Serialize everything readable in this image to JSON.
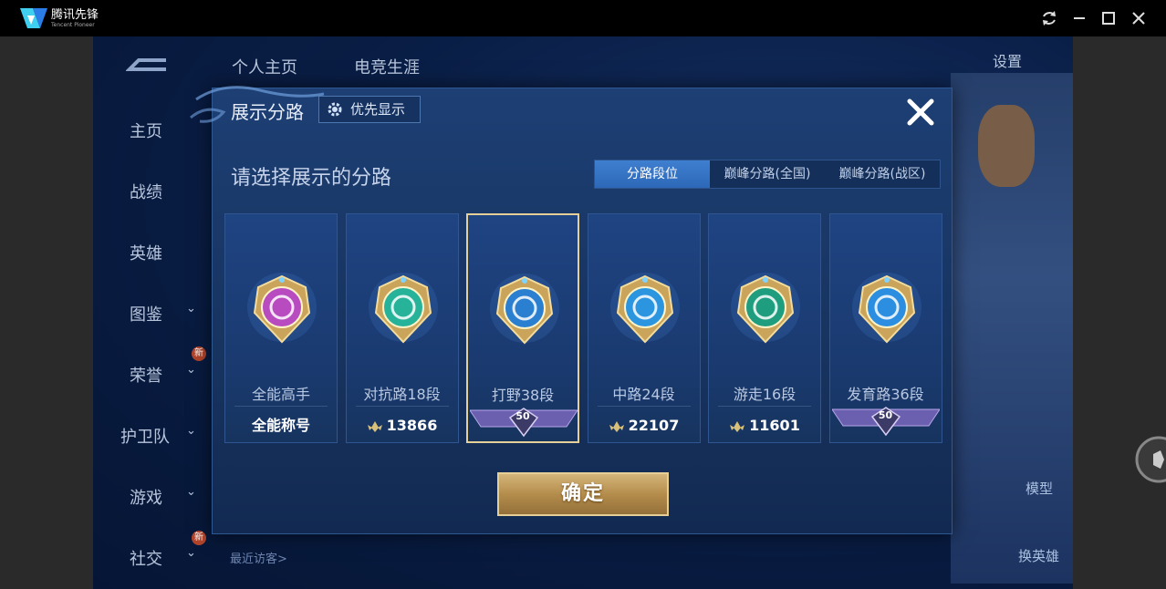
{
  "app": {
    "name": "腾讯先锋",
    "subtitle": "Tencent Pioneer"
  },
  "window_controls": [
    "refresh-icon",
    "minimize-icon",
    "maximize-icon",
    "close-icon"
  ],
  "game": {
    "top_tabs": [
      "个人主页",
      "电竞生涯"
    ],
    "sidebar": [
      "主页",
      "战绩",
      "英雄",
      "图鉴",
      "荣誉",
      "护卫队",
      "游戏",
      "社交"
    ],
    "new_badge": "新",
    "settings": "设置",
    "recent_visitors": "最近访客>",
    "right_buttons": {
      "model": "模型",
      "swap_hero": "换英雄"
    }
  },
  "modal": {
    "title": "展示分路",
    "priority_button": "优先显示",
    "subtitle": "请选择展示的分路",
    "tabs": [
      {
        "label": "分路段位",
        "active": true
      },
      {
        "label": "巅峰分路(全国)",
        "active": false
      },
      {
        "label": "巅峰分路(战区)",
        "active": false
      }
    ],
    "cards": [
      {
        "name": "全能高手",
        "footer": "全能称号",
        "kind": "title",
        "color": "#b84bc0"
      },
      {
        "name": "对抗路18段",
        "footer": "13866",
        "kind": "points",
        "color": "#27b39a"
      },
      {
        "name": "打野38段",
        "footer": "50",
        "kind": "level",
        "color": "#2a7fd0",
        "selected": true
      },
      {
        "name": "中路24段",
        "footer": "22107",
        "kind": "points",
        "color": "#2b95e0"
      },
      {
        "name": "游走16段",
        "footer": "11601",
        "kind": "points",
        "color": "#1e9e7e"
      },
      {
        "name": "发育路36段",
        "footer": "50",
        "kind": "level",
        "color": "#2c8ee0"
      }
    ],
    "confirm": "确定"
  },
  "colors": {
    "accent_gold": "#e6d09a",
    "active_tab": "#3f7fd0",
    "panel": "#1d3f74"
  }
}
